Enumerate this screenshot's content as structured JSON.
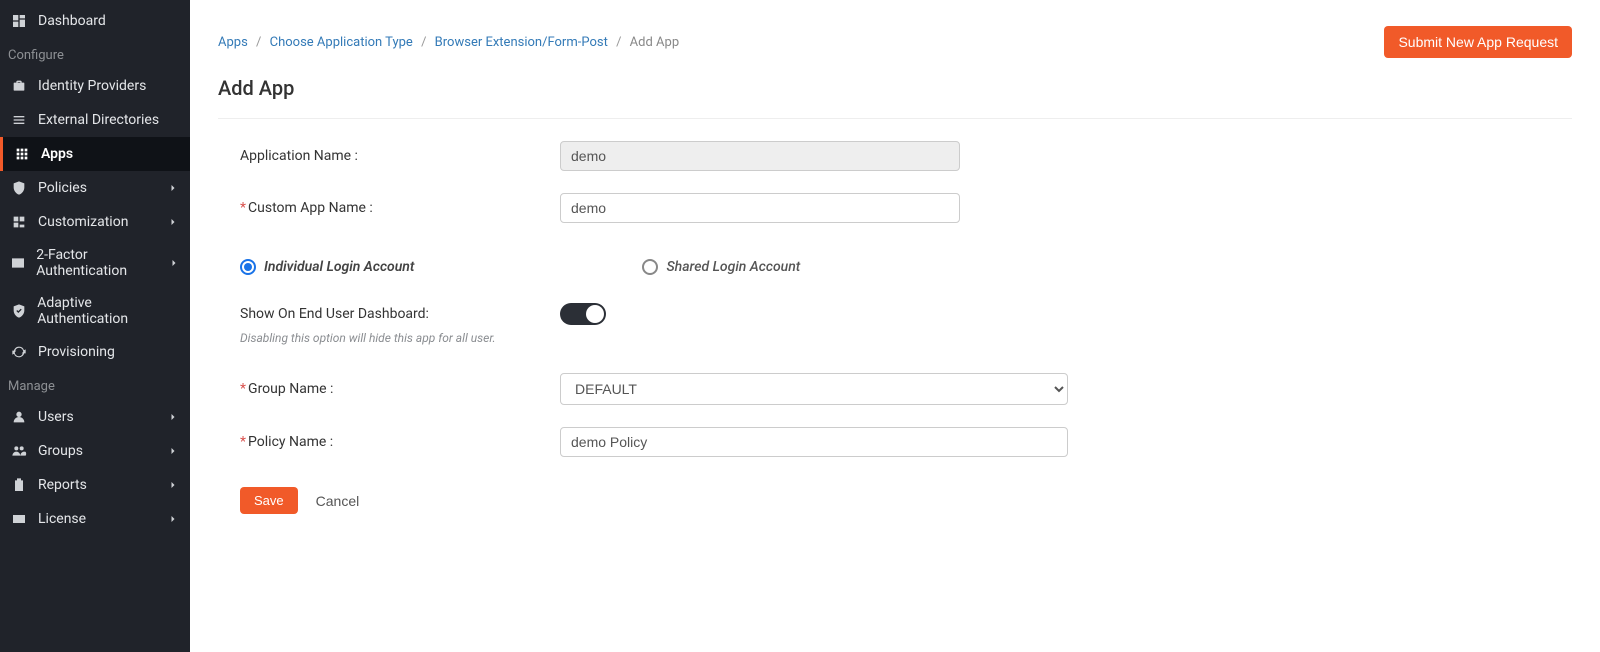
{
  "sidebar": {
    "sections": {
      "configure": "Configure",
      "manage": "Manage"
    },
    "items": [
      {
        "label": "Dashboard"
      },
      {
        "label": "Identity Providers"
      },
      {
        "label": "External Directories"
      },
      {
        "label": "Apps"
      },
      {
        "label": "Policies"
      },
      {
        "label": "Customization"
      },
      {
        "label": "2-Factor Authentication"
      },
      {
        "label": "Adaptive Authentication"
      },
      {
        "label": "Provisioning"
      },
      {
        "label": "Users"
      },
      {
        "label": "Groups"
      },
      {
        "label": "Reports"
      },
      {
        "label": "License"
      }
    ]
  },
  "breadcrumb": {
    "apps": "Apps",
    "choose": "Choose Application Type",
    "browser": "Browser Extension/Form-Post",
    "current": "Add App"
  },
  "header": {
    "submit_btn": "Submit New App Request"
  },
  "page": {
    "title": "Add App"
  },
  "form": {
    "app_name_label": "Application Name :",
    "app_name_value": "demo",
    "custom_name_label": "Custom App Name :",
    "custom_name_value": "demo",
    "login_individual": "Individual Login Account",
    "login_shared": "Shared Login Account",
    "show_dashboard_label": "Show On End User Dashboard:",
    "show_dashboard_hint": "Disabling this option will hide this app for all user.",
    "group_name_label": "Group Name :",
    "group_name_value": "DEFAULT",
    "policy_name_label": "Policy Name :",
    "policy_name_value": "demo Policy",
    "save": "Save",
    "cancel": "Cancel"
  }
}
